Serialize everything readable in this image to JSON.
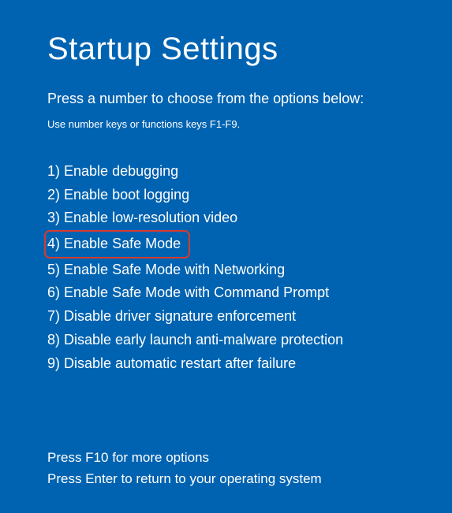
{
  "title": "Startup Settings",
  "subtitle": "Press a number to choose from the options below:",
  "hint": "Use number keys or functions keys F1-F9.",
  "options": [
    {
      "num": "1",
      "label": "Enable debugging",
      "highlighted": false
    },
    {
      "num": "2",
      "label": "Enable boot logging",
      "highlighted": false
    },
    {
      "num": "3",
      "label": "Enable low-resolution video",
      "highlighted": false
    },
    {
      "num": "4",
      "label": "Enable Safe Mode",
      "highlighted": true
    },
    {
      "num": "5",
      "label": "Enable Safe Mode with Networking",
      "highlighted": false
    },
    {
      "num": "6",
      "label": "Enable Safe Mode with Command Prompt",
      "highlighted": false
    },
    {
      "num": "7",
      "label": "Disable driver signature enforcement",
      "highlighted": false
    },
    {
      "num": "8",
      "label": "Disable early launch anti-malware protection",
      "highlighted": false
    },
    {
      "num": "9",
      "label": "Disable automatic restart after failure",
      "highlighted": false
    }
  ],
  "footer": {
    "line1": "Press F10 for more options",
    "line2": "Press Enter to return to your operating system"
  },
  "highlight_color": "#d63b2f",
  "background_color": "#0063B1"
}
